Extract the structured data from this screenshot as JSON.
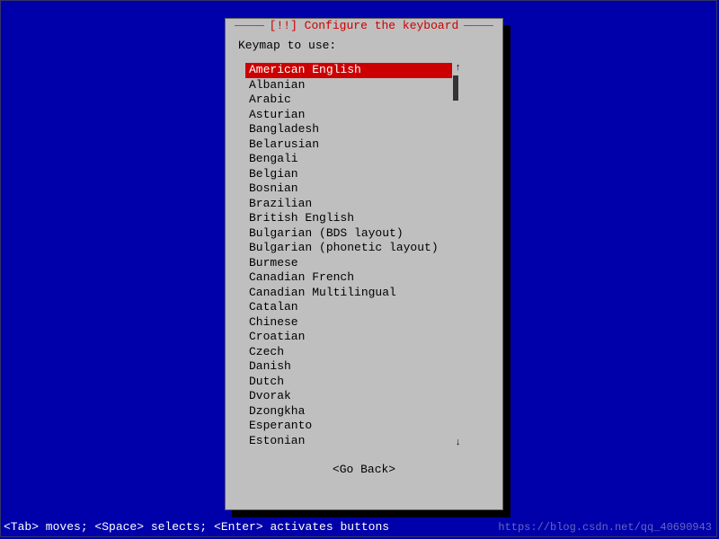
{
  "dialog": {
    "title": "[!!] Configure the keyboard",
    "prompt": "Keymap to use:",
    "selected_index": 0,
    "items": [
      "American English",
      "Albanian",
      "Arabic",
      "Asturian",
      "Bangladesh",
      "Belarusian",
      "Bengali",
      "Belgian",
      "Bosnian",
      "Brazilian",
      "British English",
      "Bulgarian (BDS layout)",
      "Bulgarian (phonetic layout)",
      "Burmese",
      "Canadian French",
      "Canadian Multilingual",
      "Catalan",
      "Chinese",
      "Croatian",
      "Czech",
      "Danish",
      "Dutch",
      "Dvorak",
      "Dzongkha",
      "Esperanto",
      "Estonian"
    ],
    "go_back": "<Go Back>"
  },
  "helpbar": "<Tab> moves; <Space> selects; <Enter> activates buttons",
  "watermark": "https://blog.csdn.net/qq_40690943"
}
